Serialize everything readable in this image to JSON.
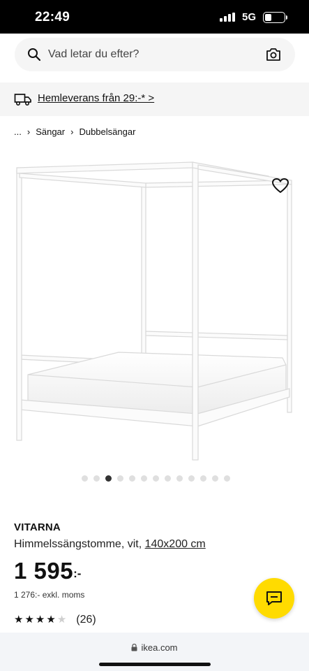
{
  "status_bar": {
    "time": "22:49",
    "network": "5G",
    "battery_level": 0.35
  },
  "search": {
    "placeholder": "Vad letar du efter?"
  },
  "delivery": {
    "text": "Hemleverans från 29:-* >"
  },
  "breadcrumb": {
    "items": [
      "...",
      "Sängar",
      "Dubbelsängar"
    ]
  },
  "gallery": {
    "dot_count": 13,
    "active_index": 2
  },
  "product": {
    "name": "VITARNA",
    "description": "Himmelssängstomme, vit, ",
    "size": "140x200 cm",
    "price": "1 595",
    "price_suffix": ":-",
    "price_excl": "1 276:- exkl. moms",
    "rating": 4,
    "rating_max": 5,
    "review_count": "(26)"
  },
  "browser": {
    "domain": "ikea.com"
  },
  "colors": {
    "accent_yellow": "#ffdb00",
    "text": "#111111"
  }
}
